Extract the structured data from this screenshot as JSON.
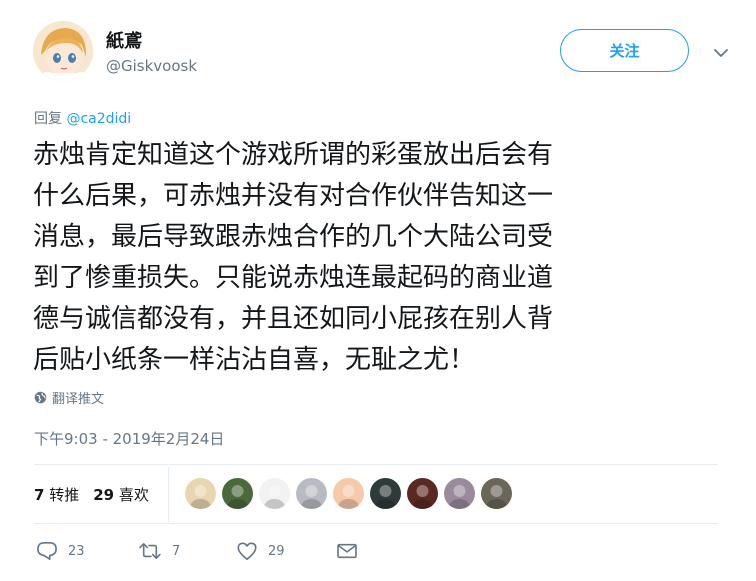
{
  "user": {
    "display_name": "紙鳶",
    "handle": "@Giskvoosk"
  },
  "follow_button": {
    "label": "关注"
  },
  "reply": {
    "prefix": "回复",
    "mention": "@ca2didi"
  },
  "tweet": {
    "text": "赤烛肯定知道这个游戏所谓的彩蛋放出后会有\n什么后果，可赤烛并没有对合作伙伴告知这一\n消息，最后导致跟赤烛合作的几个大陆公司受\n到了惨重损失。只能说赤烛连最起码的商业道\n德与诚信都没有，并且还如同小屁孩在别人背\n后贴小纸条一样沾沾自喜，无耻之尤！",
    "translate_label": "翻译推文",
    "timestamp": "下午9:03 - 2019年2月24日"
  },
  "stats": {
    "retweets_count": "7",
    "retweets_label": "转推",
    "likes_count": "29",
    "likes_label": "喜欢"
  },
  "liker_avatars": [
    {
      "color": "#e8d6b0"
    },
    {
      "color": "#4a6a3c"
    },
    {
      "color": "#f2f2f2"
    },
    {
      "color": "#b8bcc2"
    },
    {
      "color": "#f6c9a8"
    },
    {
      "color": "#2f3a3a"
    },
    {
      "color": "#5a2a22"
    },
    {
      "color": "#9a8a9c"
    },
    {
      "color": "#6a6658"
    }
  ],
  "actions": {
    "reply_count": "23",
    "retweet_count": "7",
    "like_count": "29"
  },
  "colors": {
    "accent": "#1da1f2",
    "secondary_text": "#657786",
    "divider": "#e6ecf0"
  }
}
